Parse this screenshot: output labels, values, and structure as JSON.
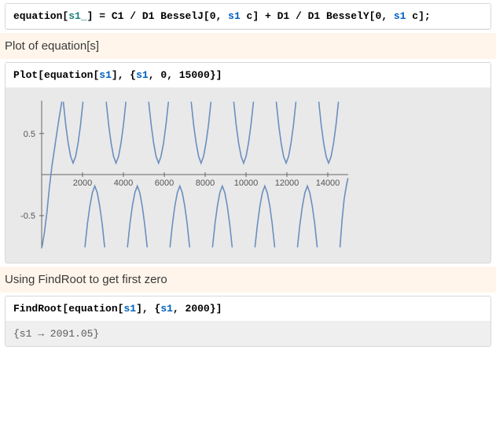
{
  "definition_cell": {
    "tokens": [
      {
        "t": "equation",
        "c": "k-black"
      },
      {
        "t": "[",
        "c": "k-black"
      },
      {
        "t": "s1_",
        "c": "k-teal"
      },
      {
        "t": "]",
        "c": "k-black"
      },
      {
        "t": " = ",
        "c": "k-black"
      },
      {
        "t": "C1",
        "c": "k-black"
      },
      {
        "t": " / ",
        "c": "k-black"
      },
      {
        "t": "D1",
        "c": "k-black"
      },
      {
        "t": " ",
        "c": "k-black"
      },
      {
        "t": "BesselJ",
        "c": "k-black"
      },
      {
        "t": "[",
        "c": "k-black"
      },
      {
        "t": "0",
        "c": "k-black"
      },
      {
        "t": ", ",
        "c": "k-black"
      },
      {
        "t": "s1",
        "c": "k-blue"
      },
      {
        "t": " c",
        "c": "k-black"
      },
      {
        "t": "]",
        "c": "k-black"
      },
      {
        "t": " + ",
        "c": "k-black"
      },
      {
        "t": "D1",
        "c": "k-black"
      },
      {
        "t": " / ",
        "c": "k-black"
      },
      {
        "t": "D1",
        "c": "k-black"
      },
      {
        "t": " ",
        "c": "k-black"
      },
      {
        "t": "BesselY",
        "c": "k-black"
      },
      {
        "t": "[",
        "c": "k-black"
      },
      {
        "t": "0",
        "c": "k-black"
      },
      {
        "t": ", ",
        "c": "k-black"
      },
      {
        "t": "s1",
        "c": "k-blue"
      },
      {
        "t": " c",
        "c": "k-black"
      },
      {
        "t": "]",
        "c": "k-black"
      },
      {
        "t": ";",
        "c": "k-black"
      }
    ]
  },
  "section1_heading": "Plot of equation[s]",
  "plot_input_cell": {
    "tokens": [
      {
        "t": "Plot",
        "c": "k-black"
      },
      {
        "t": "[",
        "c": "k-black"
      },
      {
        "t": "equation",
        "c": "k-black"
      },
      {
        "t": "[",
        "c": "k-black"
      },
      {
        "t": "s1",
        "c": "k-blue"
      },
      {
        "t": "]",
        "c": "k-black"
      },
      {
        "t": ", ",
        "c": "k-black"
      },
      {
        "t": "{",
        "c": "k-black"
      },
      {
        "t": "s1",
        "c": "k-blue"
      },
      {
        "t": ", ",
        "c": "k-black"
      },
      {
        "t": "0",
        "c": "k-black"
      },
      {
        "t": ", ",
        "c": "k-black"
      },
      {
        "t": "15000",
        "c": "k-black"
      },
      {
        "t": "}",
        "c": "k-black"
      },
      {
        "t": "]",
        "c": "k-black"
      }
    ]
  },
  "section2_heading": "Using FindRoot to get first zero",
  "findroot_input_cell": {
    "tokens": [
      {
        "t": "FindRoot",
        "c": "k-black"
      },
      {
        "t": "[",
        "c": "k-black"
      },
      {
        "t": "equation",
        "c": "k-black"
      },
      {
        "t": "[",
        "c": "k-black"
      },
      {
        "t": "s1",
        "c": "k-blue"
      },
      {
        "t": "]",
        "c": "k-black"
      },
      {
        "t": ", ",
        "c": "k-black"
      },
      {
        "t": "{",
        "c": "k-black"
      },
      {
        "t": "s1",
        "c": "k-blue"
      },
      {
        "t": ", ",
        "c": "k-black"
      },
      {
        "t": "2000",
        "c": "k-black"
      },
      {
        "t": "}",
        "c": "k-black"
      },
      {
        "t": "]",
        "c": "k-black"
      }
    ]
  },
  "findroot_output": "{s1 → 2091.05}",
  "chart_data": {
    "type": "line",
    "title": "",
    "xlabel": "",
    "ylabel": "",
    "xlim": [
      0,
      15000
    ],
    "ylim": [
      -0.9,
      0.9
    ],
    "x_ticks": [
      2000,
      4000,
      6000,
      8000,
      10000,
      12000,
      14000
    ],
    "x_tick_labels": [
      "2000",
      "4000",
      "6000",
      "8000",
      "10000",
      "12000",
      "14000"
    ],
    "y_ticks": [
      -0.5,
      0.5
    ],
    "y_tick_labels": [
      "-0.5",
      "0.5"
    ],
    "series": [
      {
        "name": "equation[s1]",
        "color": "#6b8ebf",
        "note": "Function with vertical asymptotes; segments below give sampled points between poles. y-values are approximate from the figure.",
        "segments": [
          {
            "x": [
              20,
              140,
              260,
              380,
              500,
              620,
              740,
              860,
              980
            ],
            "y": [
              -0.88,
              -0.7,
              -0.45,
              -0.15,
              0.1,
              0.3,
              0.5,
              0.7,
              0.88
            ]
          },
          {
            "x": [
              1060,
              1180,
              1300,
              1420,
              1540,
              1660,
              1780,
              1900,
              2020
            ],
            "y": [
              0.88,
              0.6,
              0.38,
              0.22,
              0.14,
              0.22,
              0.38,
              0.6,
              0.88
            ]
          },
          {
            "x": [
              2120,
              2240,
              2360,
              2480,
              2600,
              2720,
              2840,
              2960,
              3080
            ],
            "y": [
              -0.88,
              -0.6,
              -0.38,
              -0.22,
              -0.14,
              -0.22,
              -0.38,
              -0.6,
              -0.88
            ]
          },
          {
            "x": [
              3160,
              3280,
              3400,
              3520,
              3640,
              3760,
              3880,
              4000,
              4120
            ],
            "y": [
              0.88,
              0.6,
              0.38,
              0.22,
              0.14,
              0.22,
              0.38,
              0.6,
              0.88
            ]
          },
          {
            "x": [
              4200,
              4320,
              4440,
              4560,
              4680,
              4800,
              4920,
              5040,
              5160
            ],
            "y": [
              -0.88,
              -0.6,
              -0.38,
              -0.22,
              -0.14,
              -0.22,
              -0.38,
              -0.6,
              -0.88
            ]
          },
          {
            "x": [
              5240,
              5360,
              5480,
              5600,
              5720,
              5840,
              5960,
              6080,
              6200
            ],
            "y": [
              0.88,
              0.6,
              0.38,
              0.22,
              0.14,
              0.22,
              0.38,
              0.6,
              0.88
            ]
          },
          {
            "x": [
              6280,
              6400,
              6520,
              6640,
              6760,
              6880,
              7000,
              7120,
              7240
            ],
            "y": [
              -0.88,
              -0.6,
              -0.38,
              -0.22,
              -0.14,
              -0.22,
              -0.38,
              -0.6,
              -0.88
            ]
          },
          {
            "x": [
              7320,
              7440,
              7560,
              7680,
              7800,
              7920,
              8040,
              8160,
              8280
            ],
            "y": [
              0.88,
              0.6,
              0.38,
              0.22,
              0.14,
              0.22,
              0.38,
              0.6,
              0.88
            ]
          },
          {
            "x": [
              8360,
              8480,
              8600,
              8720,
              8840,
              8960,
              9080,
              9200,
              9320
            ],
            "y": [
              -0.88,
              -0.6,
              -0.38,
              -0.22,
              -0.14,
              -0.22,
              -0.38,
              -0.6,
              -0.88
            ]
          },
          {
            "x": [
              9400,
              9520,
              9640,
              9760,
              9880,
              10000,
              10120,
              10240,
              10360
            ],
            "y": [
              0.88,
              0.6,
              0.38,
              0.22,
              0.14,
              0.22,
              0.38,
              0.6,
              0.88
            ]
          },
          {
            "x": [
              10440,
              10560,
              10680,
              10800,
              10920,
              11040,
              11160,
              11280,
              11400
            ],
            "y": [
              -0.88,
              -0.6,
              -0.38,
              -0.22,
              -0.14,
              -0.22,
              -0.38,
              -0.6,
              -0.88
            ]
          },
          {
            "x": [
              11480,
              11600,
              11720,
              11840,
              11960,
              12080,
              12200,
              12320,
              12440
            ],
            "y": [
              0.88,
              0.6,
              0.38,
              0.22,
              0.14,
              0.22,
              0.38,
              0.6,
              0.88
            ]
          },
          {
            "x": [
              12520,
              12640,
              12760,
              12880,
              13000,
              13120,
              13240,
              13360,
              13480
            ],
            "y": [
              -0.88,
              -0.6,
              -0.38,
              -0.22,
              -0.14,
              -0.22,
              -0.38,
              -0.6,
              -0.88
            ]
          },
          {
            "x": [
              13560,
              13680,
              13800,
              13920,
              14040,
              14160,
              14280,
              14400,
              14520
            ],
            "y": [
              0.88,
              0.6,
              0.38,
              0.22,
              0.14,
              0.22,
              0.38,
              0.6,
              0.88
            ]
          },
          {
            "x": [
              14600,
              14700,
              14800,
              14900,
              14980
            ],
            "y": [
              -0.88,
              -0.55,
              -0.3,
              -0.15,
              -0.05
            ]
          }
        ]
      }
    ]
  }
}
